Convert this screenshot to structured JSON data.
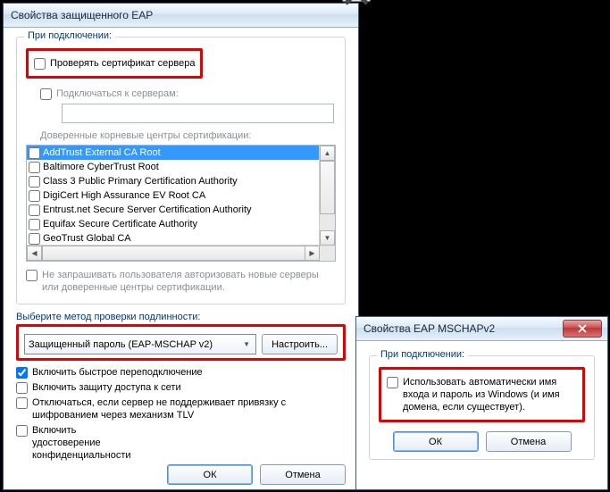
{
  "win1": {
    "title": "Свойства защищенного EAP",
    "group1_legend": "При подключении:",
    "validate_cert_label": "Проверять сертификат сервера",
    "connect_servers_label": "Подключаться к серверам:",
    "trusted_label": "Доверенные корневые центры сертификации:",
    "ca_list": [
      "AddTrust External CA Root",
      "Baltimore CyberTrust Root",
      "Class 3 Public Primary Certification Authority",
      "DigiCert High Assurance EV Root CA",
      "Entrust.net Secure Server Certification Authority",
      "Equifax Secure Certificate Authority",
      "GeoTrust Global CA"
    ],
    "no_prompt_label": "Не запрашивать пользователя авторизовать новые серверы или доверенные центры сертификации.",
    "auth_method_label": "Выберите метод проверки подлинности:",
    "auth_method_value": "Защищенный пароль (EAP-MSCHAP v2)",
    "configure_btn": "Настроить...",
    "fast_reconnect": "Включить быстрое переподключение",
    "nap": "Включить защиту доступа к сети",
    "tlv": "Отключаться, если сервер не поддерживает привязку с шифрованием через механизм TLV",
    "idpriv": "Включить удостоверение конфиденциальности",
    "ok": "ОК",
    "cancel": "Отмена"
  },
  "win2": {
    "title": "Свойства EAP MSCHAPv2",
    "group_legend": "При подключении:",
    "auto_cred": "Использовать автоматически имя входа и пароль из Windows (и имя домена, если существует).",
    "ok": "ОК",
    "cancel": "Отмена"
  }
}
